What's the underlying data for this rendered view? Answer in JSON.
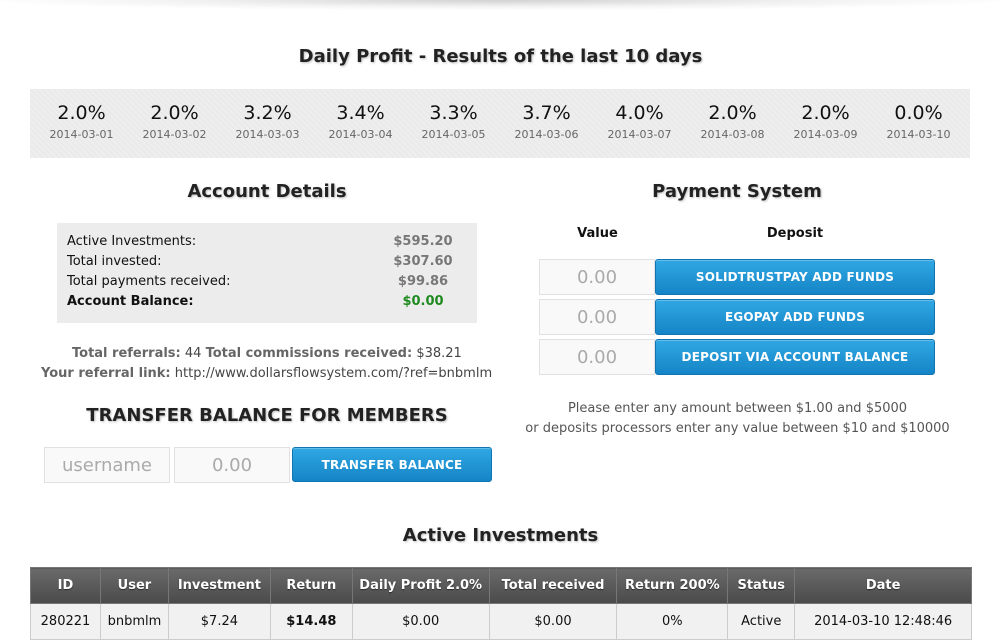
{
  "daily_profit": {
    "title": "Daily Profit - Results of the last 10 days",
    "days": [
      {
        "pct": "2.0%",
        "date": "2014-03-01"
      },
      {
        "pct": "2.0%",
        "date": "2014-03-02"
      },
      {
        "pct": "3.2%",
        "date": "2014-03-03"
      },
      {
        "pct": "3.4%",
        "date": "2014-03-04"
      },
      {
        "pct": "3.3%",
        "date": "2014-03-05"
      },
      {
        "pct": "3.7%",
        "date": "2014-03-06"
      },
      {
        "pct": "4.0%",
        "date": "2014-03-07"
      },
      {
        "pct": "2.0%",
        "date": "2014-03-08"
      },
      {
        "pct": "2.0%",
        "date": "2014-03-09"
      },
      {
        "pct": "0.0%",
        "date": "2014-03-10"
      }
    ]
  },
  "account": {
    "title": "Account Details",
    "rows": [
      {
        "label": "Active Investments:",
        "value": "$595.20"
      },
      {
        "label": "Total invested:",
        "value": "$307.60"
      },
      {
        "label": "Total payments received:",
        "value": "$99.86"
      },
      {
        "label": "Account Balance:",
        "value": "$0.00"
      }
    ],
    "referrals_label": "Total referrals:",
    "referrals_value": "44",
    "commissions_label": "Total commissions received:",
    "commissions_value": "$38.21",
    "ref_link_label": "Your referral link:",
    "ref_link_value": "http://www.dollarsflowsystem.com/?ref=bnbmlm"
  },
  "transfer": {
    "title": "TRANSFER BALANCE FOR MEMBERS",
    "username_placeholder": "username",
    "amount_placeholder": "0.00",
    "button_label": "TRANSFER BALANCE"
  },
  "payment": {
    "title": "Payment System",
    "value_header": "Value",
    "deposit_header": "Deposit",
    "options": [
      {
        "amount": "0.00",
        "button": "SOLIDTRUSTPAY ADD FUNDS"
      },
      {
        "amount": "0.00",
        "button": "EGOPAY ADD FUNDS"
      },
      {
        "amount": "0.00",
        "button": "DEPOSIT VIA ACCOUNT BALANCE"
      }
    ],
    "note_line1": "Please enter any amount between $1.00 and $5000",
    "note_line2": "or deposits processors enter any value between $10 and $10000"
  },
  "investments": {
    "title": "Active Investments",
    "headers": [
      "ID",
      "User",
      "Investment",
      "Return",
      "Daily Profit 2.0%",
      "Total received",
      "Return 200%",
      "Status",
      "Date"
    ],
    "rows": [
      [
        "280221",
        "bnbmlm",
        "$7.24",
        "$14.48",
        "$0.00",
        "$0.00",
        "0%",
        "Active",
        "2014-03-10 12:48:46"
      ]
    ]
  }
}
